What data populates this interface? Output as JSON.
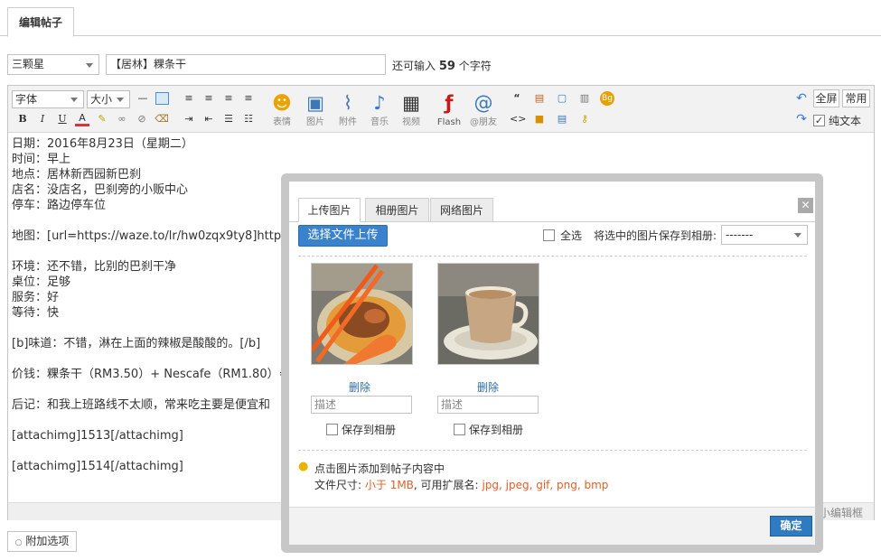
{
  "tabs": {
    "active": "编辑帖子"
  },
  "form": {
    "rating_select": "三颗星",
    "title_value": "【居林】粿条干",
    "char_prefix": "还可输入",
    "char_count": "59",
    "char_suffix": "个字符"
  },
  "toolbar": {
    "font_select": "字体",
    "size_select": "大小",
    "insert": [
      {
        "label": "表情"
      },
      {
        "label": "图片"
      },
      {
        "label": "附件"
      },
      {
        "label": "音乐"
      },
      {
        "label": "视频"
      },
      {
        "label": "Flash"
      },
      {
        "label": "@朋友"
      }
    ],
    "fullscreen": "全屏",
    "common": "常用",
    "plaintext": "纯文本"
  },
  "content": {
    "lines": [
      "日期：2016年8月23日（星期二）",
      "时间：早上",
      "地点：居林新西园新巴刹",
      "店名：没店名，巴刹旁的小贩中心",
      "停车：路边停车位",
      "",
      "地图：[url=https://waze.to/lr/hw0zqx9ty8]https:/",
      "",
      "环境：还不错，比别的巴刹干净",
      "桌位：足够",
      "服务：好",
      "等待：快",
      "",
      "[b]味道：不错，淋在上面的辣椒是酸酸的。[/b]",
      "",
      "价钱：粿条干（RM3.50）+ Nescafe（RM1.80）=",
      "",
      "后记：和我上班路线不太顺，常来吃主要是便宜和",
      "",
      "[attachimg]1513[/attachimg]",
      "",
      "[attachimg]1514[/attachimg]"
    ]
  },
  "statusbar": {
    "shrink": "缩小编辑框"
  },
  "extra_options": "附加选项",
  "dialog": {
    "tabs": [
      "上传图片",
      "相册图片",
      "网络图片"
    ],
    "upload_button": "选择文件上传",
    "select_all": "全选",
    "save_to_album_label": "将选中的图片保存到相册:",
    "album_select": "-------",
    "images": [
      {
        "delete": "删除",
        "desc_placeholder": "描述",
        "save_label": "保存到相册",
        "icon": "food-photo-noodles"
      },
      {
        "delete": "删除",
        "desc_placeholder": "描述",
        "save_label": "保存到相册",
        "icon": "food-photo-coffee"
      }
    ],
    "tip": "点击图片添加到帖子内容中",
    "file_size_label": "文件尺寸:",
    "file_size_value": "小于 1MB",
    "ext_label": ", 可用扩展名:",
    "ext_value": "jpg, jpeg, gif, png, bmp",
    "ok": "确定"
  }
}
